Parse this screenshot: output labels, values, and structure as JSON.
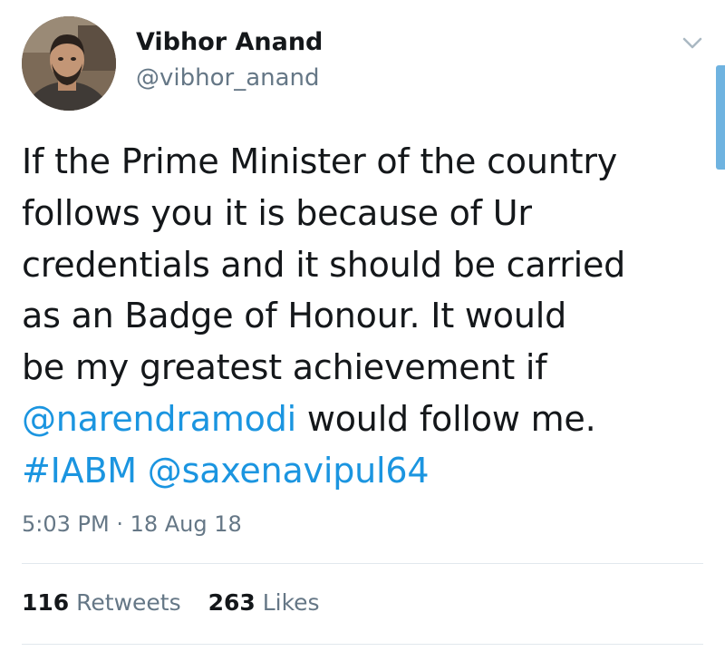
{
  "user": {
    "display_name": "Vibhor Anand",
    "handle": "@vibhor_anand",
    "avatar_icon": "profile-photo"
  },
  "menu": {
    "icon": "chevron-down-icon"
  },
  "tweet": {
    "lines": [
      "If the Prime Minister of the country",
      "follows you it is because of Ur",
      "credentials and it should be carried",
      "as an Badge of Honour. It would",
      "be my greatest achievement if"
    ],
    "line6_mention": "@narendramodi",
    "line6_text": " would follow me.",
    "hashtag": "#IABM",
    "line7_space": " ",
    "mention2": "@saxenavipul64",
    "timestamp": "5:03 PM · 18 Aug 18"
  },
  "stats": {
    "retweets_count": "116",
    "retweets_label": "Retweets",
    "likes_count": "263",
    "likes_label": "Likes"
  },
  "colors": {
    "link": "#1b95e0",
    "secondary_text": "#657786",
    "primary_text": "#14171a",
    "divider": "#e1e8ed",
    "scroll_indicator": "#6fb3e0"
  }
}
